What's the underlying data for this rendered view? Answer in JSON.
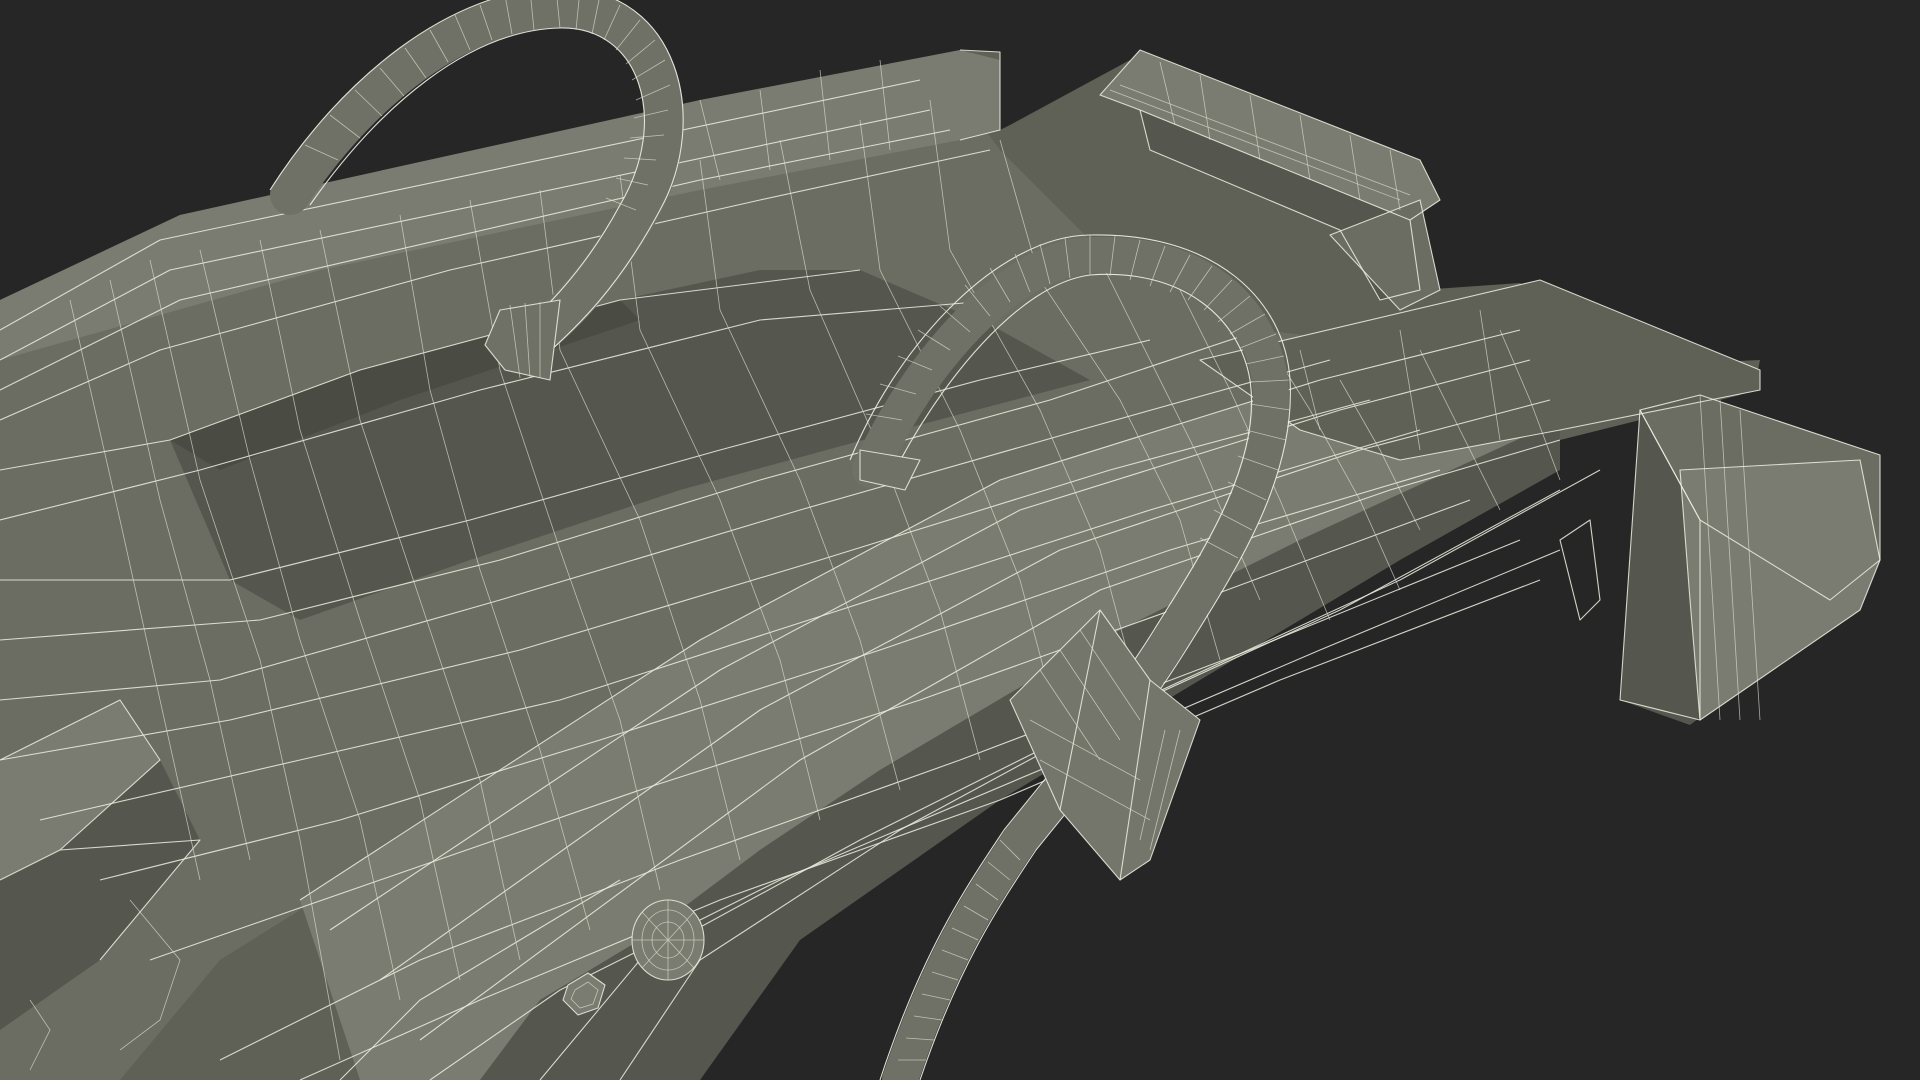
{
  "scene": {
    "subject": "stretcher-board-with-straps",
    "render_style": "wireframe-over-shaded",
    "colors": {
      "background": "#262626",
      "surface": "#6b6d63",
      "surface_dark": "#55574e",
      "surface_light": "#7a7c71",
      "wire": "#e9ecdd"
    }
  }
}
